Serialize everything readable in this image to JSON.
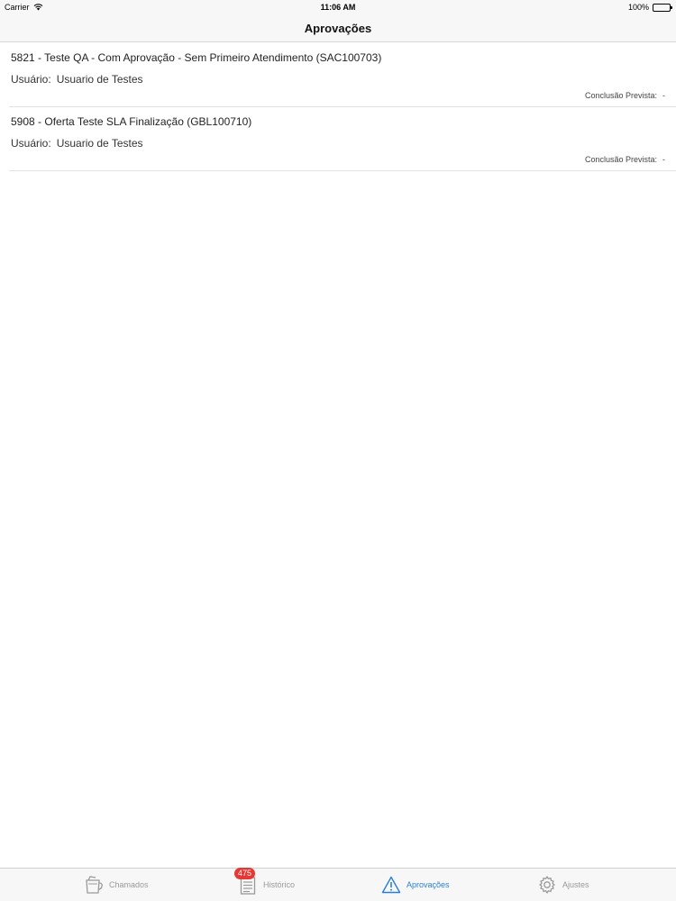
{
  "status_bar": {
    "carrier": "Carrier",
    "time": "11:06 AM",
    "battery": "100%"
  },
  "nav": {
    "title": "Aprovações"
  },
  "approvals": [
    {
      "title": "5821 - Teste QA - Com Aprovação - Sem Primeiro Atendimento (SAC100703)",
      "user_label": "Usuário:",
      "user_value": "Usuario de Testes",
      "conclusion_label": "Conclusão Prevista:",
      "conclusion_value": "-"
    },
    {
      "title": "5908 - Oferta Teste SLA Finalização (GBL100710)",
      "user_label": "Usuário:",
      "user_value": "Usuario de Testes",
      "conclusion_label": "Conclusão Prevista:",
      "conclusion_value": "-"
    }
  ],
  "tabs": [
    {
      "label": "Chamados",
      "icon": "cup-icon",
      "active": false
    },
    {
      "label": "Histórico",
      "icon": "list-document-icon",
      "badge": "475",
      "active": false
    },
    {
      "label": "Aprovações",
      "icon": "warning-icon",
      "active": true
    },
    {
      "label": "Ajustes",
      "icon": "gear-icon",
      "active": false
    }
  ],
  "colors": {
    "accent": "#2a7fd4",
    "badge": "#e53935",
    "inactive": "#999999"
  }
}
